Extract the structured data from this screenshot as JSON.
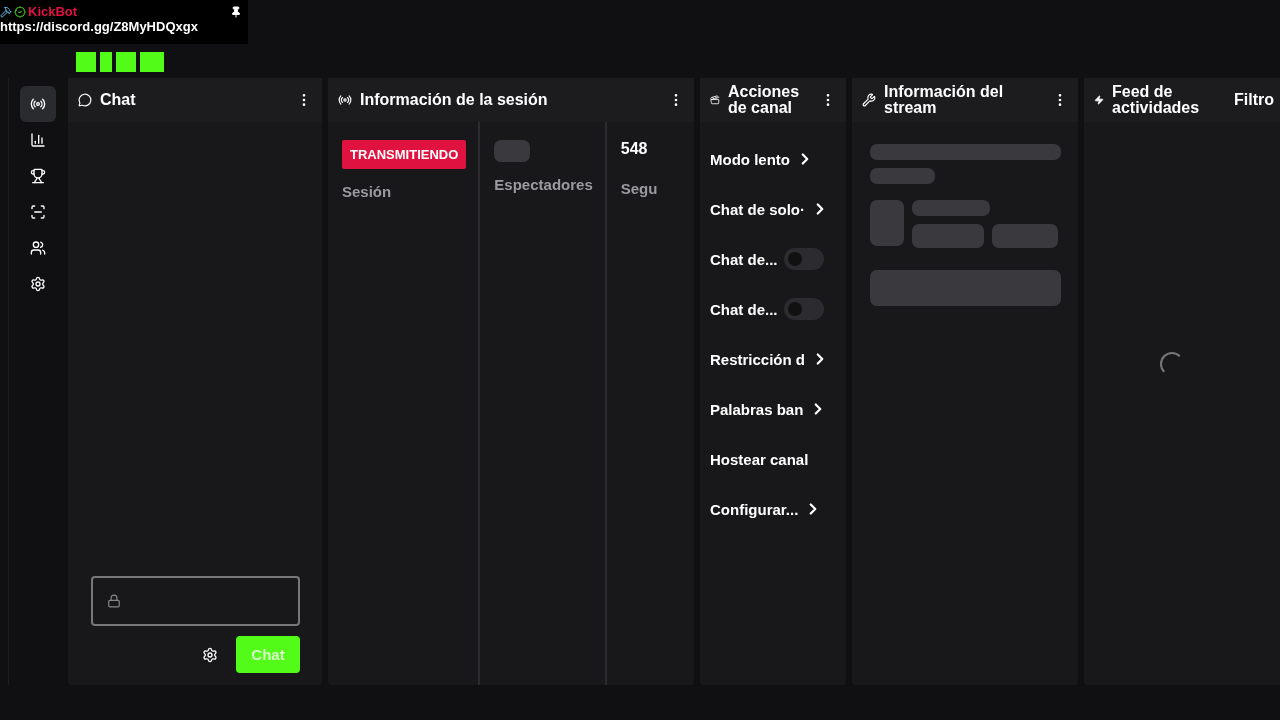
{
  "overlay": {
    "username": "KickBot",
    "link": "https://discord.gg/Z8MyHDQxgx"
  },
  "sidebar": [
    {
      "kind": "stream",
      "selected": true
    },
    {
      "kind": "stats",
      "selected": false
    },
    {
      "kind": "trophy",
      "selected": false
    },
    {
      "kind": "clip",
      "selected": false
    },
    {
      "kind": "users",
      "selected": false
    },
    {
      "kind": "settings",
      "selected": false
    }
  ],
  "chat": {
    "title": "Chat",
    "send_button": "Chat"
  },
  "session": {
    "title": "Información de la sesión",
    "stats": [
      {
        "kind": "badge",
        "value": "TRANSMITIENDO",
        "label": "Sesión"
      },
      {
        "kind": "loading",
        "label": "Espectadores"
      },
      {
        "kind": "number",
        "value": "548",
        "label": "Segu"
      }
    ]
  },
  "actions": {
    "title": "Acciones de canal",
    "items": [
      {
        "kind": "link",
        "label": "Modo lento"
      },
      {
        "kind": "link",
        "label": "Chat de solo·"
      },
      {
        "kind": "toggle",
        "label": "Chat de...",
        "on": false
      },
      {
        "kind": "toggle",
        "label": "Chat de...",
        "on": false
      },
      {
        "kind": "link",
        "label": "Restricción d"
      },
      {
        "kind": "link",
        "label": "Palabras ban"
      },
      {
        "kind": "plain",
        "label": "Hostear canal"
      },
      {
        "kind": "link",
        "label": "Configurar..."
      }
    ]
  },
  "stream_info": {
    "title": "Información del stream"
  },
  "feed": {
    "title": "Feed de actividades",
    "filter": "Filtro"
  }
}
